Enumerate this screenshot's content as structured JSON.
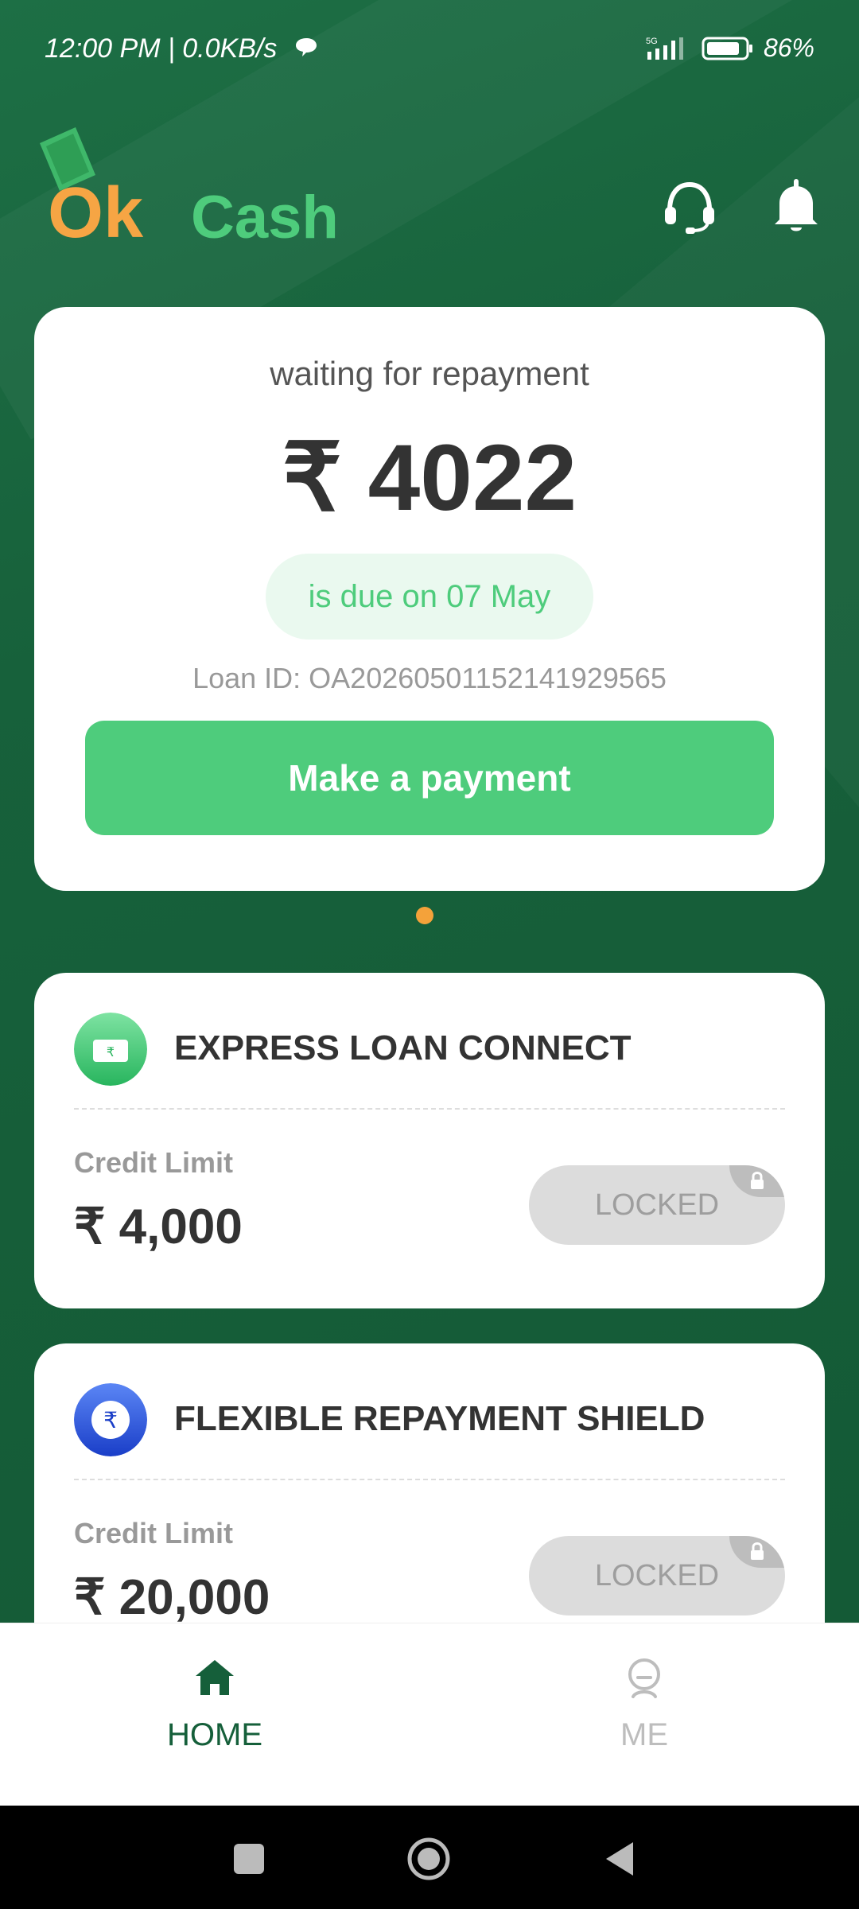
{
  "status_bar": {
    "time_speed": "12:00 PM | 0.0KB/s",
    "network": "5G",
    "battery": "86%"
  },
  "header": {
    "logo_ok": "Ok",
    "logo_cash": "Cash"
  },
  "repayment": {
    "status": "waiting for repayment",
    "amount": "₹ 4022",
    "due": "is due on 07 May",
    "loan_id": "Loan ID: OA20260501152141929565",
    "button": "Make a payment"
  },
  "products": [
    {
      "title": "EXPRESS LOAN CONNECT",
      "credit_label": "Credit Limit",
      "credit_amount": "₹ 4,000",
      "button": "LOCKED"
    },
    {
      "title": "FLEXIBLE REPAYMENT SHIELD",
      "credit_label": "Credit Limit",
      "credit_amount": "₹ 20,000",
      "button": "LOCKED"
    }
  ],
  "nav": {
    "home": "HOME",
    "me": "ME"
  },
  "colors": {
    "brand_green": "#155F3A",
    "accent_green": "#4ECC7C",
    "dot_orange": "#F4A23A"
  }
}
